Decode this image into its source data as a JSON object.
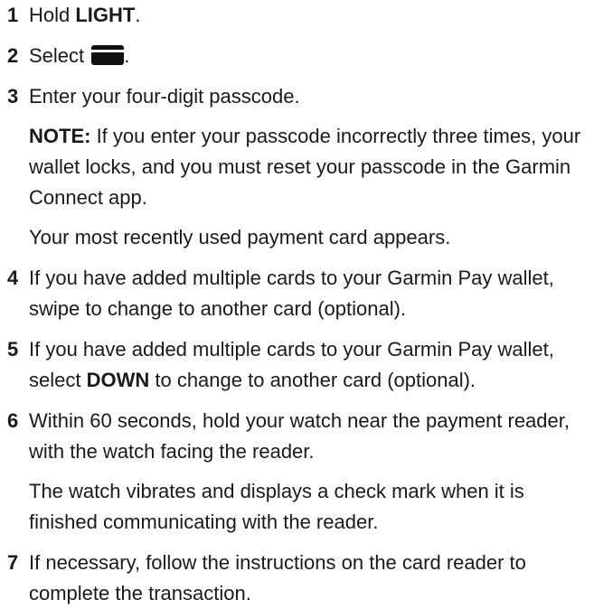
{
  "steps": [
    {
      "number": "1",
      "parts": {
        "before": "Hold ",
        "bold": "LIGHT",
        "after": "."
      }
    },
    {
      "number": "2",
      "parts": {
        "before": "Select ",
        "icon": "wallet-card-icon",
        "after": "."
      }
    },
    {
      "number": "3",
      "text": "Enter your four-digit passcode.",
      "note_label": "NOTE:",
      "note_text": " If you enter your passcode incorrectly three times, your wallet locks, and you must reset your passcode in the Garmin Connect app.",
      "result": "Your most recently used payment card appears."
    },
    {
      "number": "4",
      "text": "If you have added multiple cards to your Garmin Pay wallet, swipe to change to another card (optional)."
    },
    {
      "number": "5",
      "parts": {
        "before": "If you have added multiple cards to your Garmin Pay wallet, select ",
        "bold": "DOWN",
        "after": " to change to another card (optional)."
      }
    },
    {
      "number": "6",
      "text": "Within 60 seconds, hold your watch near the payment reader, with the watch facing the reader.",
      "result": "The watch vibrates and displays a check mark when it is finished communicating with the reader."
    },
    {
      "number": "7",
      "text": "If necessary, follow the instructions on the card reader to complete the transaction."
    }
  ]
}
